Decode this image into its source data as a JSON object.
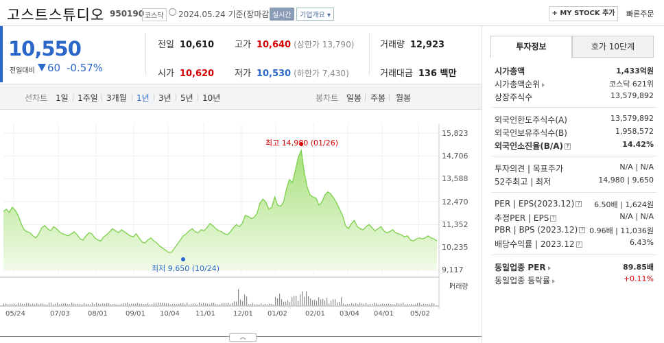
{
  "header": {
    "title": "고스트스튜디오",
    "code": "950190",
    "market": "코스닥",
    "date": "2024.05.24 기준(장마감)",
    "realtime_label": "실시간",
    "corp_info_label": "기업개요",
    "mystock_label": "+ MY STOCK 추가",
    "quick_order_label": "빠른주문"
  },
  "quote": {
    "price": "10,550",
    "change_label": "전일대비",
    "change": "60",
    "change_pct": "-0.57%"
  },
  "stats": {
    "prev_label": "전일",
    "prev_value": "10,610",
    "high_label": "고가",
    "high_value": "10,640",
    "upper_limit": "(상한가 13,790)",
    "volume_label": "거래량",
    "volume_value": "12,923",
    "open_label": "시가",
    "open_value": "10,620",
    "low_label": "저가",
    "low_value": "10,530",
    "lower_limit": "(하한가 7,430)",
    "amount_label": "거래대금",
    "amount_value": "136 백만"
  },
  "chart_tabs": {
    "line_label": "선차트",
    "periods": [
      "1일",
      "1주일",
      "3개월",
      "1년",
      "3년",
      "5년",
      "10년"
    ],
    "active": "1년",
    "candle_label": "봉차트",
    "candle_periods": [
      "일봉",
      "주봉",
      "월봉"
    ]
  },
  "chart_data": {
    "type": "area",
    "y_ticks": [
      "15,823",
      "14,706",
      "13,588",
      "12,470",
      "11,352",
      "10,235",
      "9,117"
    ],
    "ylim": [
      9117,
      15823
    ],
    "x_ticks": [
      "05/24",
      "07/03",
      "08/01",
      "09/01",
      "10/04",
      "11/01",
      "12/01",
      "01/02",
      "02/01",
      "03/04",
      "04/01",
      "05/02"
    ],
    "values": [
      12000,
      12100,
      11950,
      12200,
      12050,
      11800,
      11400,
      11100,
      11000,
      10950,
      10800,
      10700,
      10900,
      11200,
      11300,
      11150,
      11050,
      11250,
      11150,
      11000,
      10900,
      10850,
      10800,
      10900,
      11000,
      10850,
      10650,
      10600,
      10800,
      10950,
      10900,
      10700,
      10600,
      10550,
      10750,
      10850,
      11000,
      11150,
      11050,
      10950,
      11100,
      11000,
      10900,
      10800,
      10750,
      10900,
      10700,
      10500,
      10450,
      10600,
      10700,
      10550,
      10450,
      10300,
      10200,
      10100,
      9990,
      10000,
      10200,
      10400,
      10600,
      10800,
      10900,
      11050,
      11150,
      11000,
      10950,
      11100,
      11050,
      11200,
      11400,
      11300,
      11150,
      11050,
      11000,
      10900,
      10850,
      11000,
      11200,
      11350,
      11250,
      11400,
      11800,
      11750,
      11650,
      11700,
      11900,
      12400,
      12600,
      12450,
      12100,
      12200,
      12700,
      12300,
      12250,
      12450,
      13100,
      13550,
      13400,
      14000,
      14650,
      14980,
      13900,
      13200,
      12800,
      12700,
      12650,
      12300,
      12450,
      12800,
      12950,
      12850,
      12650,
      12400,
      12100,
      11800,
      11300,
      11150,
      11400,
      11550,
      11250,
      11150,
      11100,
      11250,
      11350,
      11200,
      11050,
      11150,
      11250,
      11050,
      10950,
      11000,
      11100,
      10950,
      10900,
      10850,
      10750,
      10800,
      10600,
      10550,
      10650,
      10700,
      10650,
      10700,
      10800,
      10700,
      10650,
      10550
    ],
    "high_annotation": "최고 14,980 (01/26)",
    "low_annotation": "최저 9,650 (10/24)",
    "volume_label": "거래량"
  },
  "side": {
    "tab_active": "투자정보",
    "tab_other": "호가 10단계",
    "rows1": [
      {
        "k": "시가총액",
        "v": "1,433억원",
        "bold": true
      },
      {
        "k": "시가총액순위",
        "v": "코스닥 621위"
      },
      {
        "k": "상장주식수",
        "v": "13,579,892"
      }
    ],
    "rows2": [
      {
        "k": "외국인한도주식수(A)",
        "v": "13,579,892"
      },
      {
        "k": "외국인보유주식수(B)",
        "v": "1,958,572"
      },
      {
        "k": "외국인소진율(B/A)",
        "v": "14.42%",
        "bold": true
      }
    ],
    "rows3": [
      {
        "k": "투자의견 | 목표주가",
        "v": "N/A | N/A"
      },
      {
        "k": "52주최고 | 최저",
        "v": "14,980 | 9,650"
      }
    ],
    "rows4": [
      {
        "k": "PER | EPS(2023.12)",
        "v": "6.50배 | 1,624원"
      },
      {
        "k": "추정PER | EPS",
        "v": "N/A | N/A"
      },
      {
        "k": "PBR | BPS (2023.12)",
        "v": "0.96배 | 11,036원"
      },
      {
        "k": "배당수익률 | 2023.12",
        "v": "6.43%"
      }
    ],
    "rows5": [
      {
        "k": "동일업종 PER",
        "v": "89.85배",
        "bold": true
      },
      {
        "k": "동일업종 등락률",
        "v": "+0.11%"
      }
    ]
  },
  "colors": {
    "accent_blue": "#2b66c9",
    "up_red": "#d60000",
    "area_green": "#7ccf4a"
  }
}
